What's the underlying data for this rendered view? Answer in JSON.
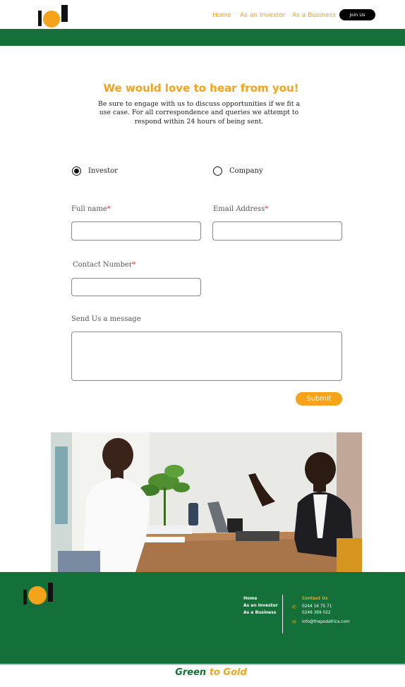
{
  "nav": {
    "home": "Home",
    "investor": "As an Investor",
    "business": "As a Business",
    "join": "Join Us"
  },
  "hero": {
    "headline": "We would love to hear from you!",
    "intro": "Be sure to engage with us to discuss opportunities if we fit a use case. For all correspondence and queries we attempt to respond within 24 hours of being sent."
  },
  "form": {
    "type_options": [
      {
        "label": "Investor",
        "selected": true
      },
      {
        "label": "Company",
        "selected": false
      }
    ],
    "full_name_label": "Full name",
    "email_label": "Email Address",
    "contact_label": "Contact Number",
    "message_label": "Send Us a message",
    "required_mark": "*",
    "full_name_value": "",
    "email_value": "",
    "contact_value": "",
    "message_value": "",
    "submit": "Submit"
  },
  "footer": {
    "links": [
      "Home",
      "As an Investor",
      "As a Business"
    ],
    "contact_title": "Contact Us",
    "phone1": "0244 16 75 71",
    "phone2": "0246 369 022",
    "email": "info@thepodafrica.com",
    "tagline_part1": "Green",
    "tagline_part2": " to Gold"
  },
  "colors": {
    "brand_green": "#127038",
    "brand_orange": "#f5a31a"
  }
}
